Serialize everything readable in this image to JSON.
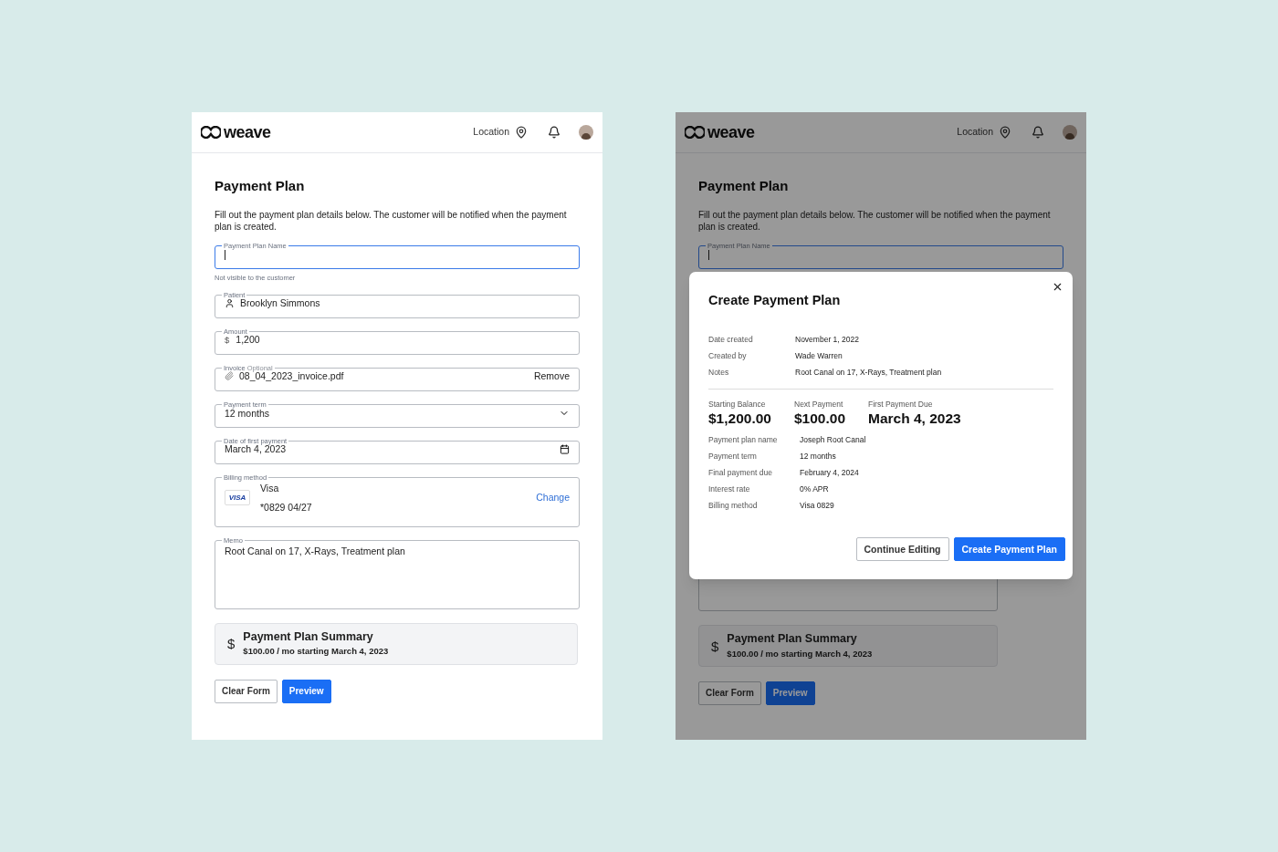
{
  "form_screen": {
    "header": {
      "logo": "weave",
      "location": "Location"
    },
    "title": "Payment Plan",
    "description": "Fill out the payment plan details below. The customer will be notified when the payment plan is created.",
    "fields": [
      {
        "kind": "text",
        "label": "Payment Plan Name",
        "focused": true,
        "helper": "Not visible to the customer"
      },
      {
        "kind": "person",
        "label": "Patient",
        "focused": false,
        "value": "Brooklyn Simmons"
      },
      {
        "kind": "currency",
        "label": "Amount",
        "focused": false,
        "prefix": "$",
        "value": "1,200"
      },
      {
        "kind": "file",
        "label": "Invoice",
        "focused": false,
        "hint": "Optional",
        "value": "08_04_2023_invoice.pdf",
        "action": "Remove"
      },
      {
        "kind": "select",
        "label": "Payment term",
        "focused": false,
        "value": "12 months"
      },
      {
        "kind": "date",
        "label": "Date of first payment",
        "focused": false,
        "value": "March 4, 2023"
      },
      {
        "kind": "card",
        "label": "Billing method",
        "focused": false,
        "badge": "VISA",
        "card_name": "Visa",
        "card_number": "*0829  04/27",
        "action": "Change"
      },
      {
        "kind": "memo",
        "label": "Memo",
        "focused": false,
        "value": "Root Canal on 17, X-Rays, Treatment plan"
      }
    ],
    "summary": {
      "symbol": "$",
      "title": "Payment Plan Summary",
      "detail": "$100.00 / mo starting March 4, 2023"
    },
    "buttons": [
      {
        "label": "Clear Form",
        "kind": "secondary"
      },
      {
        "label": "Preview",
        "kind": "primary"
      }
    ]
  },
  "dialog_screen": {
    "background": {
      "header": {
        "logo": "weave",
        "location": "Location"
      },
      "title": "Payment Plan",
      "description": "Fill out the payment plan details below. The customer will be notified when the payment plan is created.",
      "fields": [
        {
          "kind": "text",
          "label": "Payment Plan Name",
          "focused": true
        }
      ],
      "summary": {
        "symbol": "$",
        "title": "Payment Plan Summary",
        "detail": "$100.00 / mo starting March 4, 2023"
      },
      "buttons": [
        {
          "label": "Clear Form",
          "kind": "secondary"
        },
        {
          "label": "Preview",
          "kind": "primary"
        }
      ]
    },
    "modal": {
      "title": "Create Payment Plan",
      "meta": [
        {
          "label": "Date created",
          "value": "November 1, 2022"
        },
        {
          "label": "Created by",
          "value": "Wade Warren"
        },
        {
          "label": "Notes",
          "value": "Root Canal on 17, X-Rays, Treatment plan"
        }
      ],
      "stats": [
        {
          "label": "Starting Balance",
          "value": "$1,200.00"
        },
        {
          "label": "Next Payment",
          "value": "$100.00"
        },
        {
          "label": "First Payment Due",
          "value": "March 4, 2023"
        }
      ],
      "details": [
        {
          "label": "Payment plan name",
          "value": "Joseph Root Canal"
        },
        {
          "label": "Payment term",
          "value": "12 months"
        },
        {
          "label": "Final payment due",
          "value": "February 4, 2024"
        },
        {
          "label": "Interest rate",
          "value": "0% APR"
        },
        {
          "label": "Billing method",
          "value": "Visa 0829"
        }
      ],
      "buttons": [
        {
          "label": "Continue Editing",
          "kind": "secondary"
        },
        {
          "label": "Create Payment Plan",
          "kind": "primary"
        }
      ]
    }
  }
}
